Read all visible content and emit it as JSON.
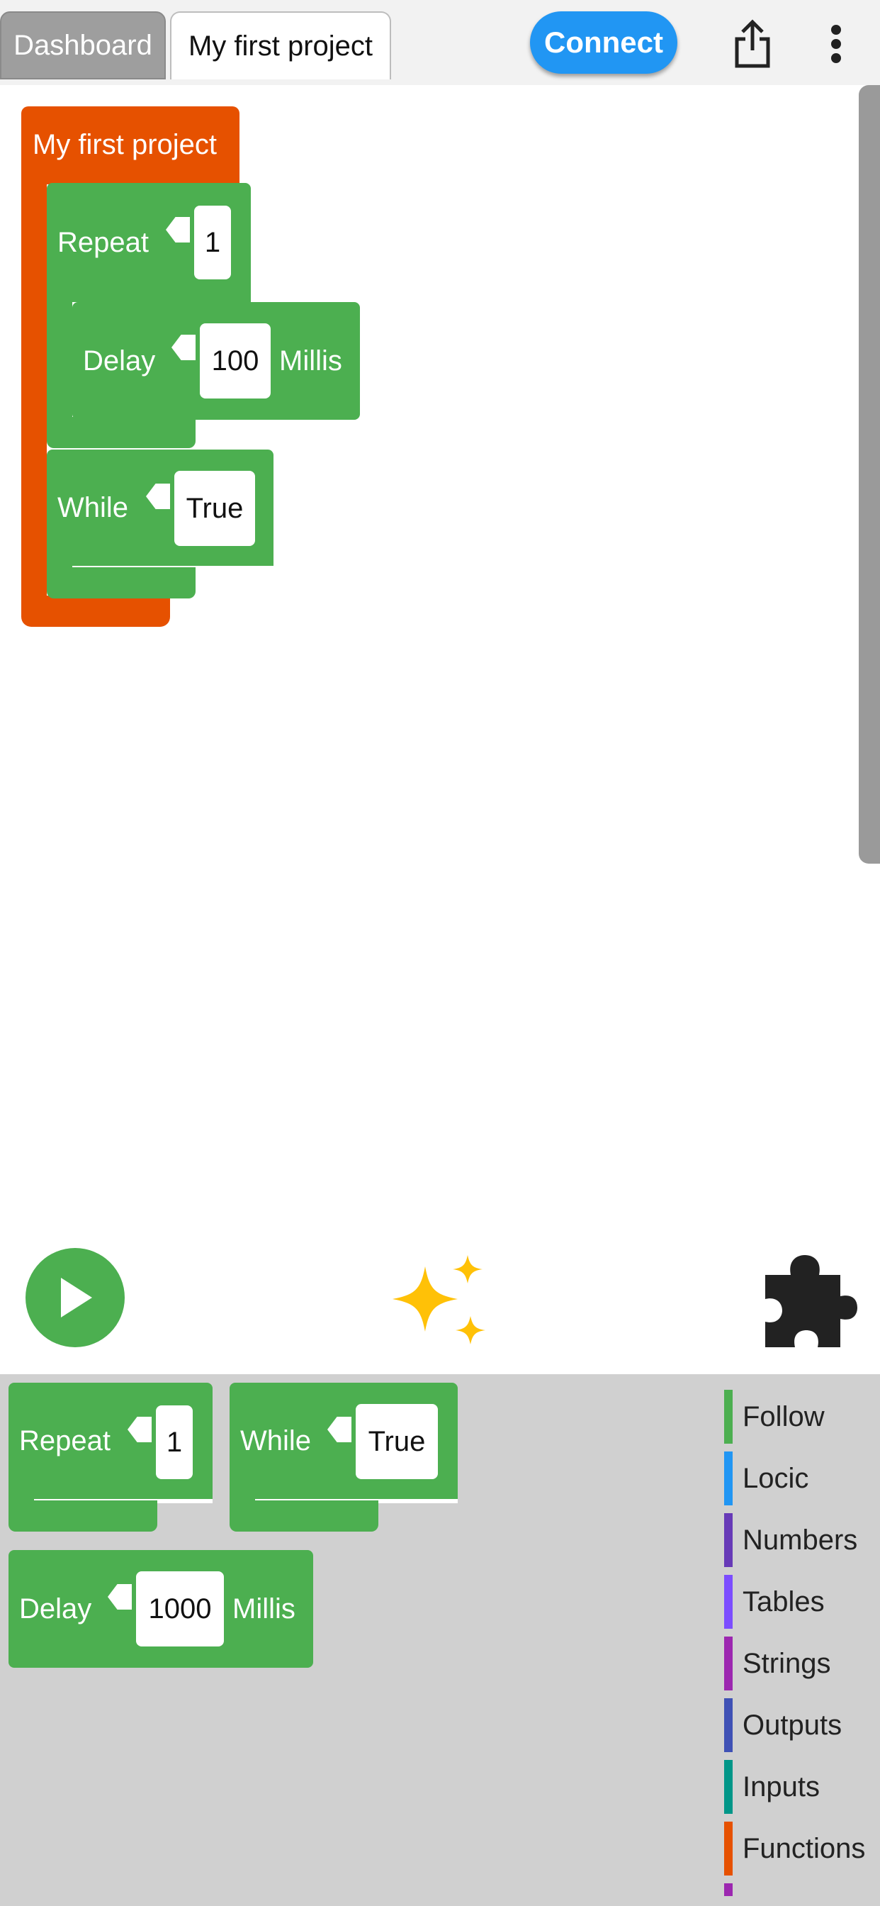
{
  "tabs": {
    "dashboard": "Dashboard",
    "project": "My first project"
  },
  "toolbar": {
    "connect_label": "Connect",
    "share_icon": "share-icon",
    "more_icon": "more-vert-icon"
  },
  "workspace": {
    "project_block": "My first project",
    "repeat_label": "Repeat",
    "repeat_value": "1",
    "delay_label": "Delay",
    "delay_value": "100",
    "delay_unit": "Millis",
    "while_label": "While",
    "while_value": "True"
  },
  "tools": {
    "run_icon": "play-icon",
    "ai_icon": "sparkle-icon",
    "extensions_icon": "puzzle-icon"
  },
  "flyout": {
    "repeat_label": "Repeat",
    "repeat_value": "1",
    "while_label": "While",
    "while_value": "True",
    "delay_label": "Delay",
    "delay_value": "1000",
    "delay_unit": "Millis"
  },
  "categories": [
    {
      "label": "Follow",
      "color": "#4caf50"
    },
    {
      "label": "Locic",
      "color": "#2196f3"
    },
    {
      "label": "Numbers",
      "color": "#673ab7"
    },
    {
      "label": "Tables",
      "color": "#7c4dff"
    },
    {
      "label": "Strings",
      "color": "#9c27b0"
    },
    {
      "label": "Outputs",
      "color": "#3f51b5"
    },
    {
      "label": "Inputs",
      "color": "#009688"
    },
    {
      "label": "Functions",
      "color": "#e65100"
    }
  ],
  "colors": {
    "block_orange": "#e65100",
    "block_green": "#4caf50",
    "connect_blue": "#2196f3",
    "sparkle_yellow": "#ffc107"
  }
}
